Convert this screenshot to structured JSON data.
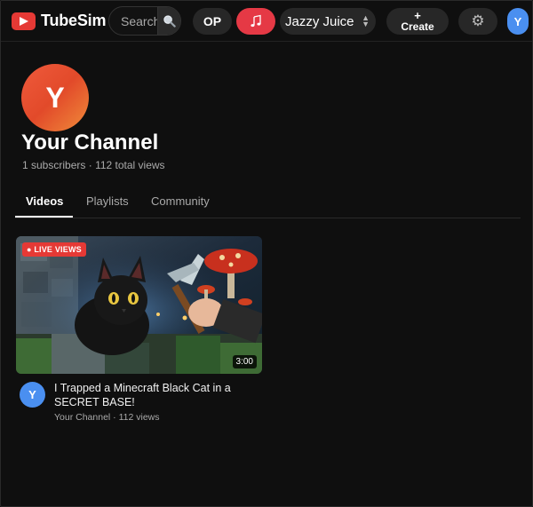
{
  "app": {
    "name": "TubeSim"
  },
  "header": {
    "search_placeholder": "Search",
    "op_label": "OP",
    "music_icon": "music-note-icon",
    "selected_option": "Jazzy Juice",
    "create_plus": "+",
    "create_label": "Create",
    "settings_icon": "gear-icon",
    "avatar_letter": "Y"
  },
  "channel": {
    "avatar_letter": "Y",
    "name": "Your Channel",
    "subscribers": "1 subscribers",
    "separator": "·",
    "views": "112 total views"
  },
  "tabs": [
    {
      "label": "Videos",
      "active": true
    },
    {
      "label": "Playlists",
      "active": false
    },
    {
      "label": "Community",
      "active": false
    }
  ],
  "video": {
    "badge": "● LIVE VIEWS",
    "duration": "3:00",
    "avatar_letter": "Y",
    "title": "I Trapped a Minecraft Black Cat in a SECRET BASE!",
    "channel": "Your Channel",
    "separator": "·",
    "views": "112 views"
  },
  "colors": {
    "accent": "#e53935",
    "avatar": "#4a8ff0",
    "background": "#0f0f0f"
  }
}
